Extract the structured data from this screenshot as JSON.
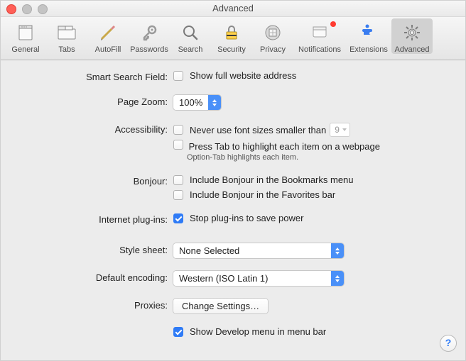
{
  "window": {
    "title": "Advanced"
  },
  "toolbar": {
    "items": [
      {
        "label": "General"
      },
      {
        "label": "Tabs"
      },
      {
        "label": "AutoFill"
      },
      {
        "label": "Passwords"
      },
      {
        "label": "Search"
      },
      {
        "label": "Security"
      },
      {
        "label": "Privacy"
      },
      {
        "label": "Notifications"
      },
      {
        "label": "Extensions"
      },
      {
        "label": "Advanced"
      }
    ],
    "selected_index": 9
  },
  "sections": {
    "smart_search": {
      "label": "Smart Search Field:",
      "show_full_url": {
        "label": "Show full website address",
        "checked": false
      }
    },
    "page_zoom": {
      "label": "Page Zoom:",
      "value": "100%"
    },
    "accessibility": {
      "label": "Accessibility:",
      "font_size": {
        "label": "Never use font sizes smaller than",
        "checked": false,
        "value": "9"
      },
      "press_tab": {
        "label": "Press Tab to highlight each item on a webpage",
        "checked": false,
        "hint": "Option-Tab highlights each item."
      }
    },
    "bonjour": {
      "label": "Bonjour:",
      "bookmarks": {
        "label": "Include Bonjour in the Bookmarks menu",
        "checked": false
      },
      "favorites": {
        "label": "Include Bonjour in the Favorites bar",
        "checked": false
      }
    },
    "plugins": {
      "label": "Internet plug-ins:",
      "stop": {
        "label": "Stop plug-ins to save power",
        "checked": true
      }
    },
    "stylesheet": {
      "label": "Style sheet:",
      "value": "None Selected"
    },
    "encoding": {
      "label": "Default encoding:",
      "value": "Western (ISO Latin 1)"
    },
    "proxies": {
      "label": "Proxies:",
      "button": "Change Settings…"
    },
    "develop": {
      "label": "Show Develop menu in menu bar",
      "checked": true
    }
  },
  "help_button": "?"
}
